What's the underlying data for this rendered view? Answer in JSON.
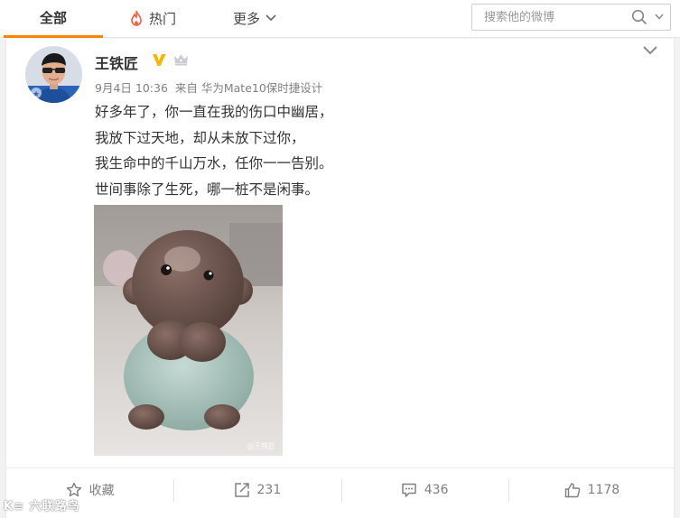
{
  "tabs": {
    "all": "全部",
    "hot": "热门",
    "more": "更多"
  },
  "search": {
    "placeholder": "搜索他的微博"
  },
  "post": {
    "author": "王铁匠",
    "date": "9月4日 10:36",
    "source": "来自 华为Mate10保时捷设计",
    "lines": [
      "好多年了，你一直在我的伤口中幽居，",
      "我放下过天地，却从未放下过你，",
      "我生命中的千山万水，任你一一告别。",
      "世间事除了生死，哪一桩不是闲事。"
    ],
    "image_watermark": "@王铁匠"
  },
  "actions": {
    "favorite": "收藏",
    "repost": "231",
    "comment": "436",
    "like": "1178"
  },
  "footer_watermark": "K≡ 六联路鸟",
  "colors": {
    "accent": "#ff8200",
    "verified": "#f7b500",
    "hot_icon": "#ff5a3c"
  },
  "icons": [
    "flame-icon",
    "chevron-down-icon",
    "search-icon",
    "verified-v-icon",
    "crown-icon",
    "star-icon",
    "share-icon",
    "comment-icon",
    "thumbs-up-icon"
  ]
}
